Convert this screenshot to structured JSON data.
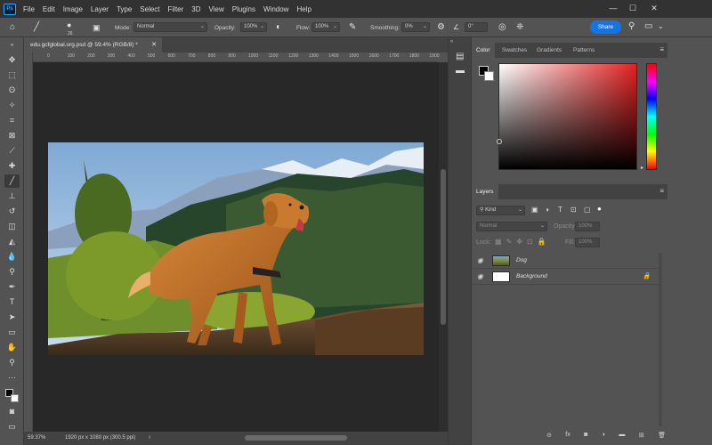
{
  "menubar": {
    "app_logo": "Ps",
    "items": [
      "File",
      "Edit",
      "Image",
      "Layer",
      "Type",
      "Select",
      "Filter",
      "3D",
      "View",
      "Plugins",
      "Window",
      "Help"
    ]
  },
  "options": {
    "brush_size": "26",
    "mode_label": "Mode:",
    "mode_value": "Normal",
    "opacity_label": "Opacity:",
    "opacity_value": "100%",
    "flow_label": "Flow:",
    "flow_value": "100%",
    "smoothing_label": "Smoothing:",
    "smoothing_value": "0%",
    "angle_value": "0°",
    "share_label": "Share"
  },
  "document": {
    "tab_title": "edu.gcfglobal.org.psd @ 59.4% (RGB/8) *",
    "zoom": "59.37%",
    "dimensions": "1920 px x 1080 px (300.5 ppi)",
    "ruler_ticks": [
      "0",
      "50",
      "100",
      "150",
      "200",
      "250",
      "300",
      "350",
      "400",
      "450",
      "500",
      "550",
      "600",
      "650",
      "700",
      "750",
      "800",
      "850",
      "900",
      "950",
      "1000",
      "1050",
      "1100",
      "1150",
      "1200",
      "1250",
      "1300",
      "1350",
      "1400",
      "1450",
      "1500",
      "1550",
      "1600",
      "1650",
      "1700",
      "1750",
      "1800",
      "1850",
      "1900",
      "1950",
      "2000",
      "2050",
      "2100"
    ]
  },
  "color_panel": {
    "tabs": [
      "Color",
      "Swatches",
      "Gradients",
      "Patterns"
    ],
    "foreground": "#000000",
    "background": "#ffffff",
    "hue_color": "#e32222"
  },
  "layers_panel": {
    "tab": "Layers",
    "filter": "Kind",
    "blend_mode": "Normal",
    "opacity_label": "Opacity:",
    "opacity_value": "100%",
    "lock_label": "Lock:",
    "fill_label": "Fill:",
    "fill_value": "100%",
    "layers": [
      {
        "name": "Dog"
      },
      {
        "name": "Background"
      }
    ]
  }
}
